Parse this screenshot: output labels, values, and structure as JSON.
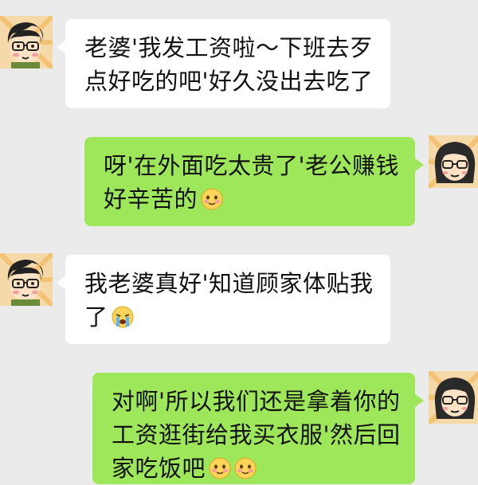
{
  "messages": [
    {
      "side": "left",
      "sender": "husband",
      "lines": [
        "老婆'我发工资啦～下班去歹",
        "点好吃的吧'好久没出去吃了"
      ],
      "emojis": []
    },
    {
      "side": "right",
      "sender": "wife",
      "lines": [
        "呀'在外面吃太贵了'老公赚钱",
        "好辛苦的"
      ],
      "emojis": [
        "blush-emoji"
      ]
    },
    {
      "side": "left",
      "sender": "husband",
      "lines": [
        "我老婆真好'知道顾家体贴我",
        "了"
      ],
      "emojis": [
        "crying-emoji"
      ]
    },
    {
      "side": "right",
      "sender": "wife",
      "lines": [
        "对啊'所以我们还是拿着你的",
        "工资逛街给我买衣服'然后回",
        "家吃饭吧"
      ],
      "emojis": [
        "blush-emoji",
        "blush-emoji"
      ]
    }
  ],
  "colors": {
    "background": "#ebebeb",
    "left_bubble": "#ffffff",
    "right_bubble": "#9fe75a"
  }
}
